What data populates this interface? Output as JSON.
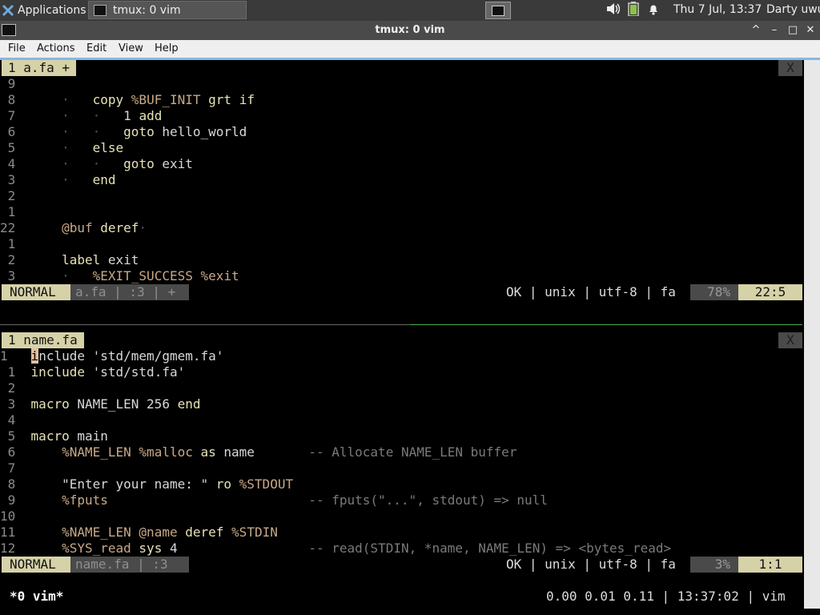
{
  "panel": {
    "applications_label": "Applications",
    "task_label": "tmux: 0 vim",
    "clock": "Thu  7 Jul, 13:37",
    "user": "Darty uwu"
  },
  "window": {
    "title": "tmux: 0 vim",
    "controls": [
      "^",
      "–",
      "□",
      "✕"
    ]
  },
  "menubar": {
    "items": [
      "File",
      "Actions",
      "Edit",
      "View",
      "Help"
    ]
  },
  "top_pane": {
    "tab_label": "1 a.fa +",
    "close_label": "X",
    "lines": [
      {
        "n": " 9",
        "code": ""
      },
      {
        "n": " 8",
        "code": "    ·   copy %BUF_INIT grt if"
      },
      {
        "n": " 7",
        "code": "    ·   ·   1 add"
      },
      {
        "n": " 6",
        "code": "    ·   ·   goto hello_world"
      },
      {
        "n": " 5",
        "code": "    ·   else"
      },
      {
        "n": " 4",
        "code": "    ·   ·   goto exit"
      },
      {
        "n": " 3",
        "code": "    ·   end"
      },
      {
        "n": " 2",
        "code": ""
      },
      {
        "n": " 1",
        "code": ""
      },
      {
        "n": "22",
        "code": "    @buf deref·"
      },
      {
        "n": " 1",
        "code": ""
      },
      {
        "n": " 2",
        "code": "    label exit"
      },
      {
        "n": " 3",
        "code": "    ·   %EXIT_SUCCESS %exit"
      }
    ],
    "status": {
      "mode": "NORMAL",
      "fileinfo": "a.fa | :3 | +",
      "right": "OK | unix | utf-8 | fa",
      "percent": "78%",
      "position": "22:5"
    }
  },
  "bottom_pane": {
    "tab_label": "1 name.fa",
    "close_label": "X",
    "lines": [
      {
        "n": "1 ",
        "code": "include 'std/mem/gmem.fa'"
      },
      {
        "n": " 1",
        "code": "include 'std/std.fa'"
      },
      {
        "n": " 2",
        "code": ""
      },
      {
        "n": " 3",
        "code": "macro NAME_LEN 256 end"
      },
      {
        "n": " 4",
        "code": ""
      },
      {
        "n": " 5",
        "code": "macro main"
      },
      {
        "n": " 6",
        "code": "    %NAME_LEN %malloc as name       -- Allocate NAME_LEN buffer"
      },
      {
        "n": " 7",
        "code": ""
      },
      {
        "n": " 8",
        "code": "    \"Enter your name: \" ro %STDOUT"
      },
      {
        "n": " 9",
        "code": "    %fputs                          -- fputs(\"...\", stdout) => null"
      },
      {
        "n": "10",
        "code": ""
      },
      {
        "n": "11",
        "code": "    %NAME_LEN @name deref %STDIN"
      },
      {
        "n": "12",
        "code": "    %SYS_read sys 4                 -- read(STDIN, *name, NAME_LEN) => <bytes_read>"
      }
    ],
    "status": {
      "mode": "NORMAL",
      "fileinfo": "name.fa | :3",
      "right": "OK | unix | utf-8 | fa",
      "percent": "3%",
      "position": "1:1"
    }
  },
  "tmux": {
    "window": "*0 vim*",
    "right": "0.00 0.01 0.11 | 13:37:02 | vim"
  }
}
